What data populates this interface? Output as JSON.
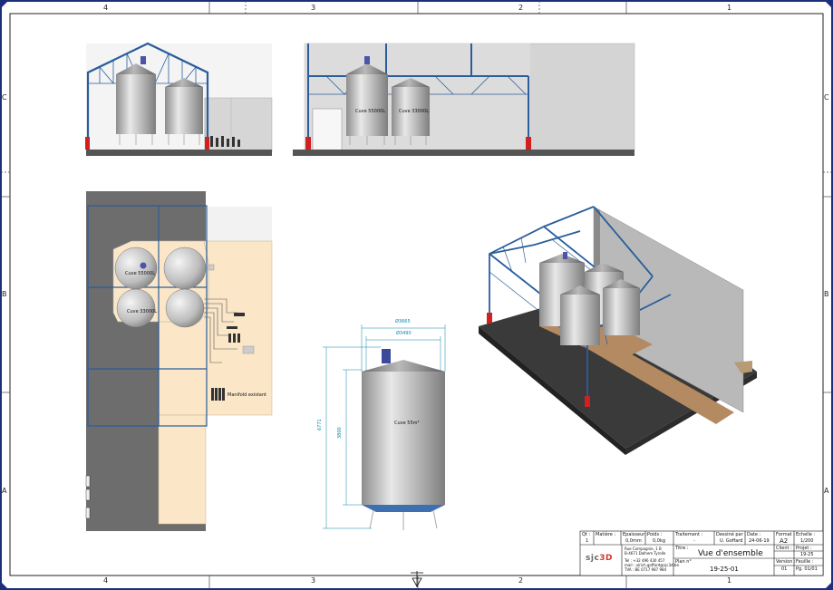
{
  "frame": {
    "zones_top": [
      "4",
      "3",
      "2",
      "1"
    ],
    "zones_bottom": [
      "4",
      "3",
      "2",
      "1"
    ],
    "zones_left": [
      "C",
      "B",
      "A"
    ],
    "zones_right": [
      "C",
      "B",
      "A"
    ]
  },
  "views": {
    "front_elevation": {
      "tank_labels": [
        "Cuve 55000L",
        "Cuve 33000L"
      ]
    },
    "top_view": {
      "tank_labels": [
        "Cuve 55000L",
        "Cuve 33000L"
      ],
      "manifold_label": "Manifold existant"
    },
    "tank_detail": {
      "tank_label": "Cuve 55m³",
      "dim_outer_diameter": "Ø3665",
      "dim_inner_diameter": "Ø3490",
      "dim_total_height": "6771",
      "dim_shell_height": "3800"
    }
  },
  "title_block": {
    "qty_label": "Qt :",
    "qty_value": "1",
    "material_label": "Matière :",
    "material_value": "",
    "thickness_label": "Epaisseur :",
    "thickness_value": "0,0mm",
    "weight_label": "Poids :",
    "weight_value": "0,0kg",
    "treatment_label": "Traitement :",
    "treatment_value": "-",
    "drawn_by_label": "Dessiné par :",
    "drawn_by_value": "U. Goffard",
    "date_label": "Date :",
    "date_value": "24-06-19",
    "format_label": "Format :",
    "format_value": "A2",
    "scale_label": "Echelle :",
    "scale_value": "1/200",
    "company_line1": "Rue Compagnie, 1 B",
    "company_line2": "B-4671 Dalhem Tyrolle",
    "company_line3": "Tel : +32 496 430 457",
    "company_line4": "mail : ulrich.goffard@sjc3d.be",
    "company_line5": "TVA : BE 0717 987 984",
    "logo_text_left": "sjc",
    "logo_text_right": "3D",
    "title_label": "Titre :",
    "title_value": "Vue d'ensemble",
    "client_label": "Client :",
    "client_value": "",
    "project_label": "Projet :",
    "project_value": "19-25",
    "plan_label": "Plan n°",
    "plan_value": "19-25-01",
    "version_label": "Version :",
    "version_value": "01",
    "sheet_label": "Feuille :",
    "sheet_value": "Pg. 01/01"
  },
  "colors": {
    "frame_blue": "#1c2f7a",
    "steel_blue": "#2a5d9c",
    "column_red": "#d02020",
    "wall_grey": "#d8d8d8",
    "dark_wall": "#6d6d6d",
    "floor_beige": "#fbe6c8",
    "dim_cyan": "#0a86a8"
  }
}
